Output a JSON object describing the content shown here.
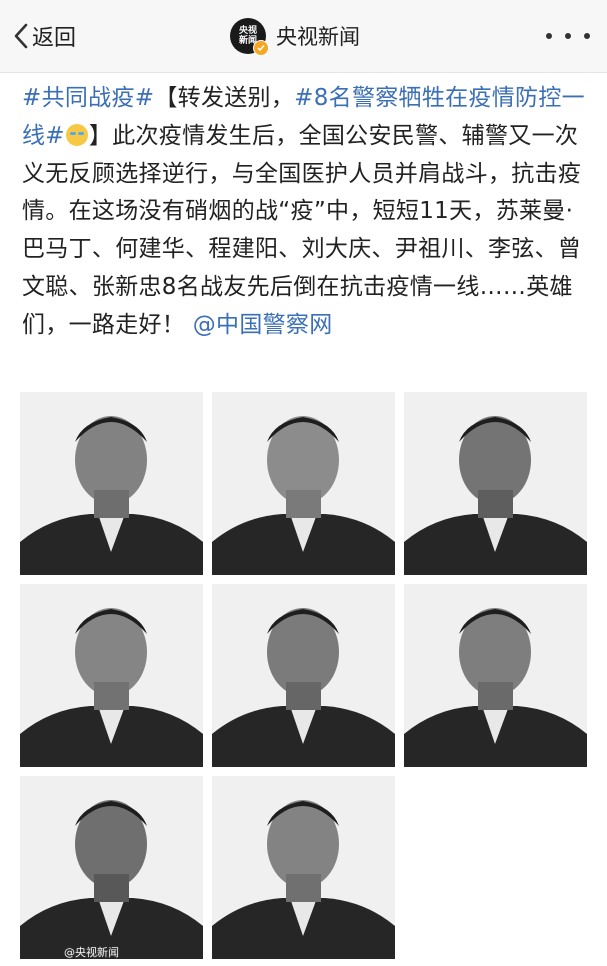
{
  "navbar": {
    "back_label": "返回",
    "logo_text": "央视新闻",
    "account_name": "央视新闻"
  },
  "post": {
    "tag1": "#共同战疫#",
    "t1": "【转发送别，",
    "tag2": "#8名警察牺牲在疫情防控一线#",
    "t2": "】此次疫情发生后，全国公安民警、辅警又一次义无反顾选择逆行，与全国医护人员并肩战斗，抗击疫情。在这场没有硝烟的战“疫”中，短短11天，苏莱曼·巴马丁、何建华、程建阳、刘大庆、尹祖川、李弦、曾文聪、张新忠8名战友先后倒在抗击疫情一线……英雄们，一路走好！",
    "mention": "@中国警察网"
  },
  "photos": [
    {
      "name": "photo-1",
      "desc": "portrait"
    },
    {
      "name": "photo-2",
      "desc": "portrait"
    },
    {
      "name": "photo-3",
      "desc": "portrait"
    },
    {
      "name": "photo-4",
      "desc": "portrait"
    },
    {
      "name": "photo-5",
      "desc": "portrait"
    },
    {
      "name": "photo-6",
      "desc": "portrait"
    },
    {
      "name": "photo-7",
      "desc": "portrait"
    },
    {
      "name": "photo-8",
      "desc": "portrait"
    }
  ],
  "watermark": "@央视新闻",
  "colors": {
    "link": "#3b6fb6",
    "navbar_bg": "#f7f7f7"
  },
  "icons": {
    "back": "chevron-left-icon",
    "more": "more-dots-icon",
    "verified": "verified-badge-icon"
  }
}
